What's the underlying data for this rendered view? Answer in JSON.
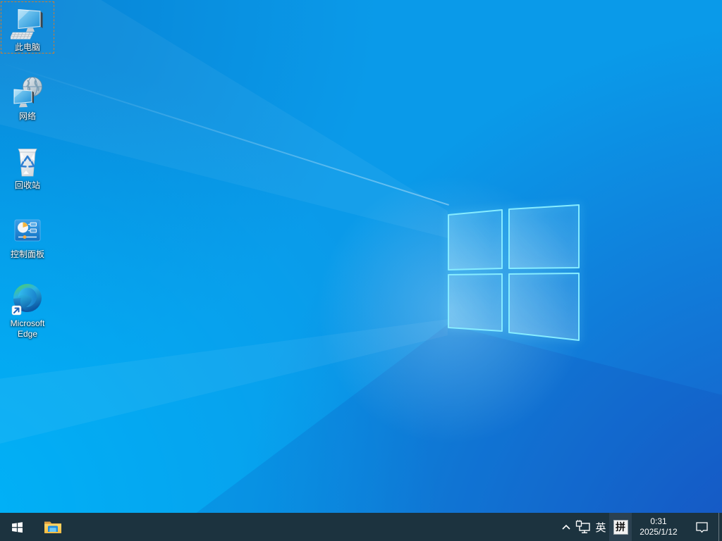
{
  "wallpaper": {
    "base_color": "#0a9ae9",
    "corner_dark_color": "#1a50c2",
    "corner_bright_color": "#00b2f7",
    "logo_edge_color": "#86ecff"
  },
  "desktop_icons": [
    {
      "label": "此电脑",
      "selected": true
    },
    {
      "label": "网络",
      "selected": false
    },
    {
      "label": "回收站",
      "selected": false
    },
    {
      "label": "控制面板",
      "selected": false
    },
    {
      "label": "Microsoft Edge",
      "selected": false
    }
  ],
  "taskbar": {
    "background_color": "#1c333f",
    "tray": {
      "language_indicator": "英",
      "ime_mode": "拼",
      "time": "0:31",
      "date": "2025/1/12"
    }
  }
}
